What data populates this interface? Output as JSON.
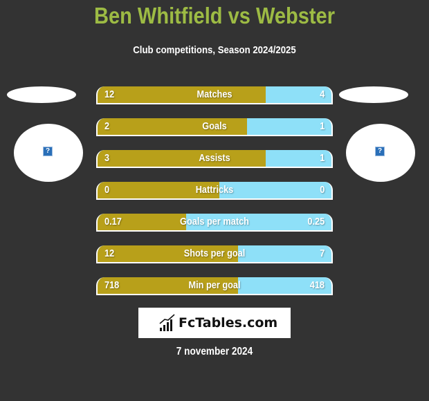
{
  "header": {
    "title": "Ben Whitfield vs Webster",
    "subtitle": "Club competitions, Season 2024/2025"
  },
  "players": {
    "left": {
      "name": "Ben Whitfield",
      "avatar_icon": "question-icon"
    },
    "right": {
      "name": "Webster",
      "avatar_icon": "question-icon"
    }
  },
  "colors": {
    "left_bar": "#b8a01a",
    "right_bar": "#8ee0f8",
    "title": "#9dbb44",
    "background": "#333333"
  },
  "stats": [
    {
      "label": "Matches",
      "left": "12",
      "right": "4",
      "left_share": 0.72
    },
    {
      "label": "Goals",
      "left": "2",
      "right": "1",
      "left_share": 0.64
    },
    {
      "label": "Assists",
      "left": "3",
      "right": "1",
      "left_share": 0.72
    },
    {
      "label": "Hattricks",
      "left": "0",
      "right": "0",
      "left_share": 0.52
    },
    {
      "label": "Goals per match",
      "left": "0.17",
      "right": "0.25",
      "left_share": 0.38
    },
    {
      "label": "Shots per goal",
      "left": "12",
      "right": "7",
      "left_share": 0.6
    },
    {
      "label": "Min per goal",
      "left": "718",
      "right": "418",
      "left_share": 0.6
    }
  ],
  "footer": {
    "logo_text": "FcTables.com",
    "logo_icon": "bar-chart-icon",
    "date": "7 november 2024"
  }
}
